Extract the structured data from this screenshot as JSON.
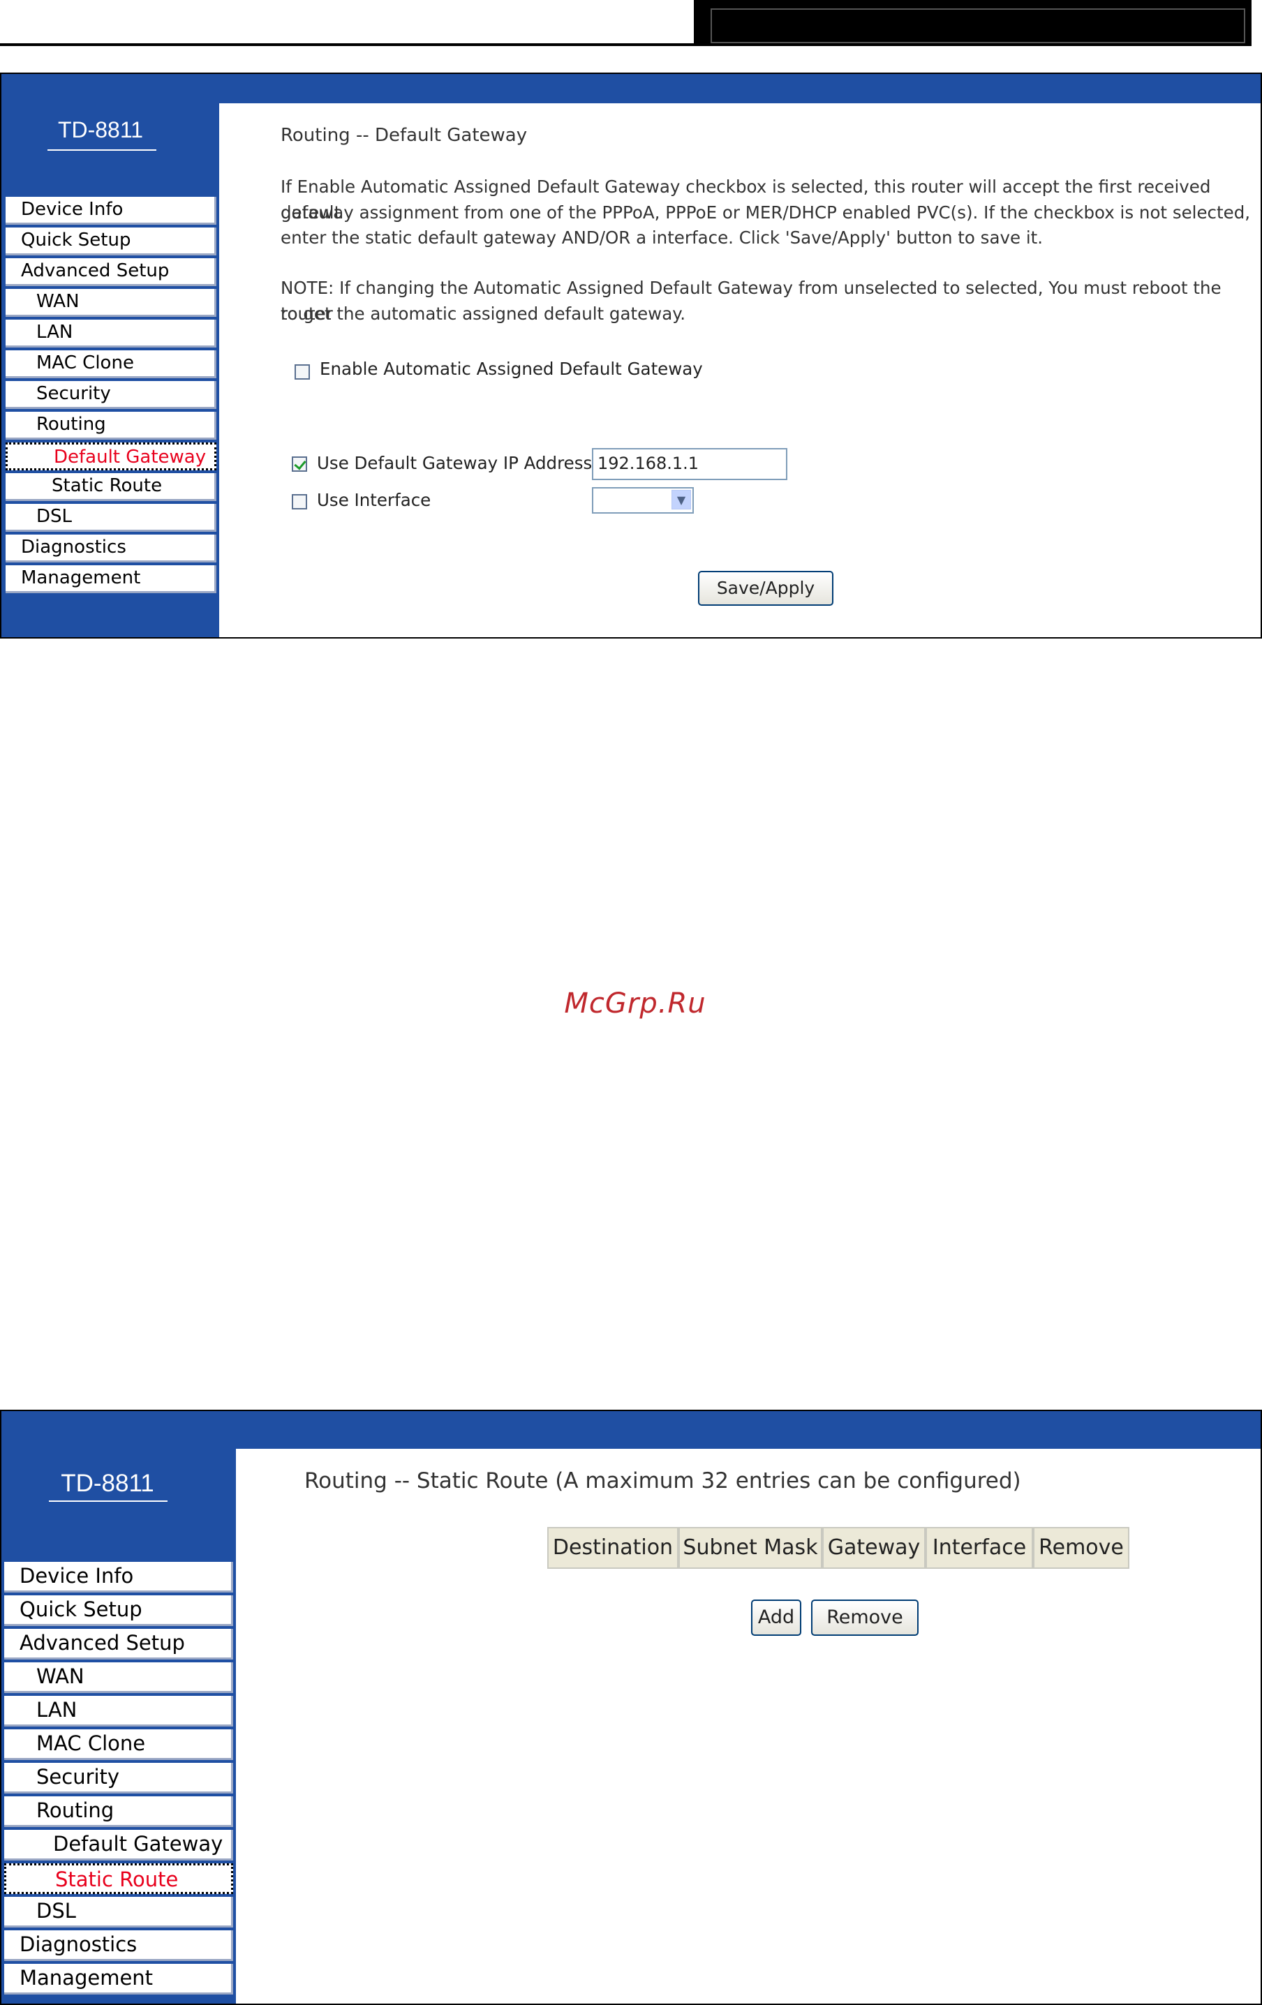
{
  "brand": {
    "model": "TD-8811"
  },
  "colors": {
    "frame_blue": "#1f4fa3",
    "active_red": "#e8001c",
    "watermark": "#c0282d"
  },
  "menu": [
    "Device Info",
    "Quick Setup",
    "Advanced Setup",
    "WAN",
    "LAN",
    "MAC Clone",
    "Security",
    "Routing",
    "Default Gateway",
    "Static Route",
    "DSL",
    "Diagnostics",
    "Management"
  ],
  "screen1": {
    "active_item": "Default Gateway",
    "title": "Routing -- Default Gateway",
    "desc_lines": [
      "If Enable Automatic Assigned Default Gateway checkbox is selected, this router will accept the first received default",
      "gateway assignment from one of the PPPoA, PPPoE or MER/DHCP enabled PVC(s). If the checkbox is not selected,",
      "enter the static default gateway AND/OR a interface. Click 'Save/Apply' button to save it."
    ],
    "note_lines": [
      "NOTE: If changing the Automatic Assigned Default Gateway from unselected to selected, You must reboot the router",
      "to get the automatic assigned default gateway."
    ],
    "auto_gateway_label": "Enable Automatic Assigned Default Gateway",
    "auto_gateway_checked": false,
    "use_gw_ip_label": "Use Default Gateway IP Address",
    "use_gw_ip_checked": true,
    "gw_ip_value": "192.168.1.1",
    "use_interface_label": "Use Interface",
    "use_interface_checked": false,
    "interface_value": "",
    "save_label": "Save/Apply"
  },
  "watermark": "McGrp.Ru",
  "screen2": {
    "active_item": "Static Route",
    "title": "Routing -- Static Route (A maximum 32 entries can be configured)",
    "columns": [
      "Destination",
      "Subnet Mask",
      "Gateway",
      "Interface",
      "Remove"
    ],
    "add_label": "Add",
    "remove_label": "Remove"
  }
}
